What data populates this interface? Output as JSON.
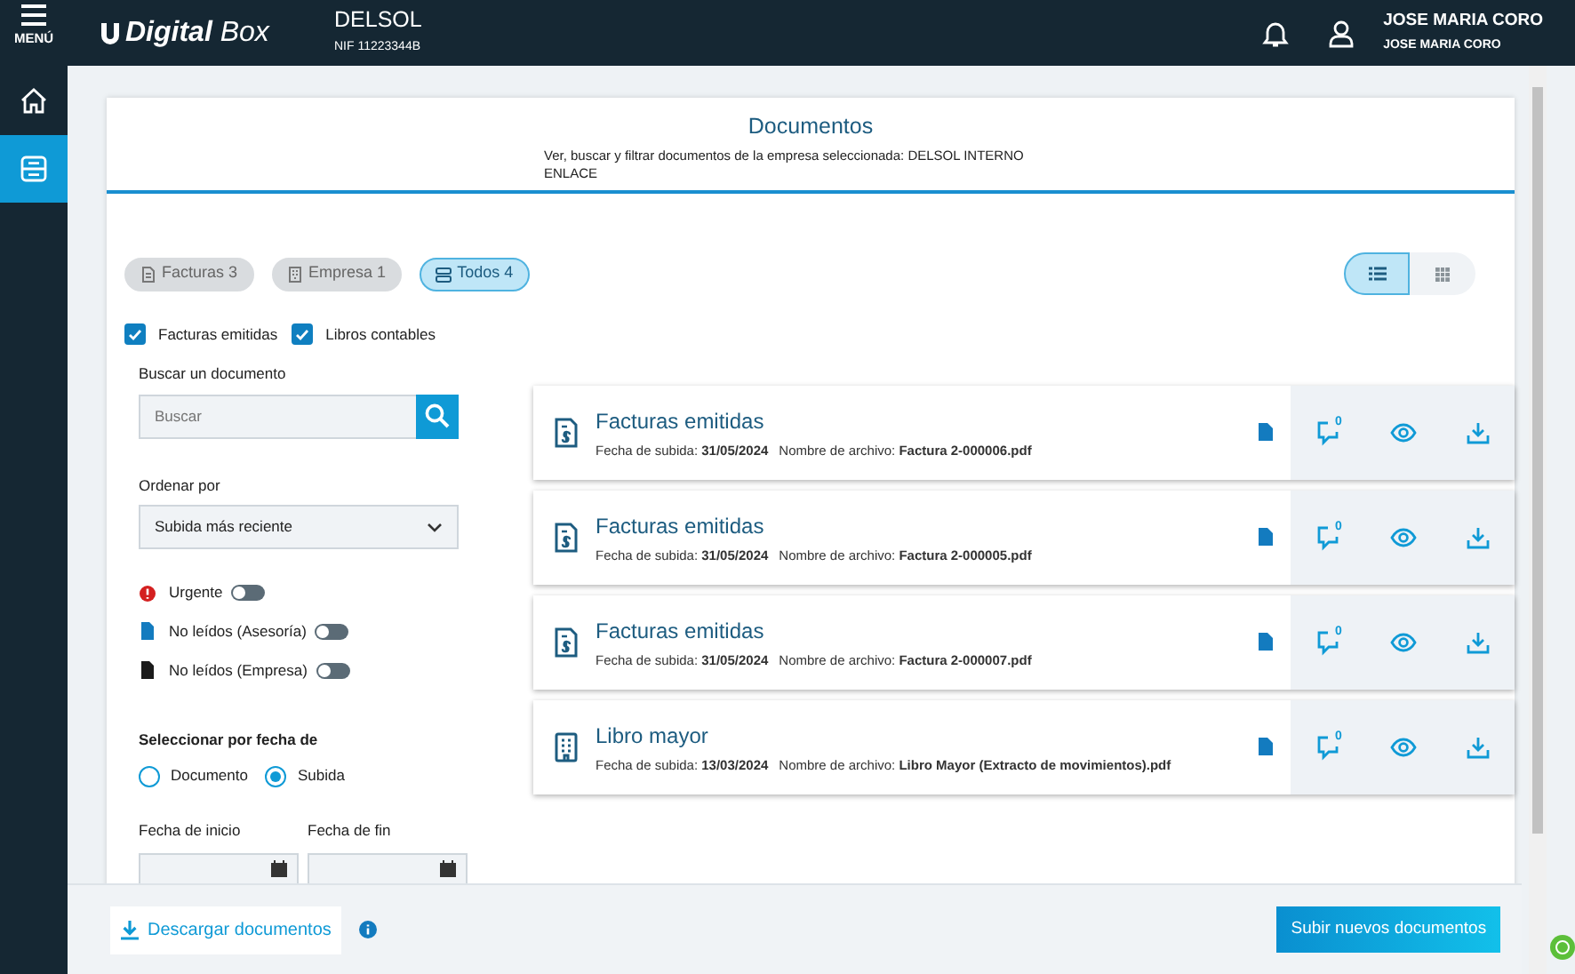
{
  "header": {
    "menu_label": "MENÚ",
    "brand_bold": "Digital",
    "brand_light": "Box",
    "company": "DELSOL",
    "nif": "NIF 11223344B",
    "user_name": "JOSE MARIA CORO",
    "user_sub": "JOSE MARIA CORO"
  },
  "sidebar": {
    "items": [
      {
        "kind": "home",
        "selected": false
      },
      {
        "kind": "documents",
        "selected": true
      }
    ]
  },
  "page": {
    "title": "Documentos",
    "subtitle": "Ver, buscar y filtrar documentos de la empresa seleccionada: DELSOL INTERNO ENLACE"
  },
  "chips": [
    {
      "kind": "invoice",
      "label": "Facturas 3",
      "selected": false
    },
    {
      "kind": "company",
      "label": "Empresa 1",
      "selected": false
    },
    {
      "kind": "all",
      "label": "Todos 4",
      "selected": true
    }
  ],
  "view_toggle": [
    {
      "kind": "list",
      "selected": true
    },
    {
      "kind": "grid",
      "selected": false
    }
  ],
  "type_filters": [
    {
      "label": "Facturas emitidas",
      "checked": true
    },
    {
      "label": "Libros contables",
      "checked": true
    }
  ],
  "search": {
    "label": "Buscar un documento",
    "placeholder": "Buscar"
  },
  "sort": {
    "label": "Ordenar por",
    "value": "Subida más reciente"
  },
  "toggles": [
    {
      "kind": "urgent",
      "label": "Urgente",
      "on": false
    },
    {
      "kind": "unread_advisor",
      "label": "No leídos (Asesoría)",
      "on": false
    },
    {
      "kind": "unread_company",
      "label": "No leídos (Empresa)",
      "on": false
    }
  ],
  "date_mode": {
    "label": "Seleccionar por fecha de",
    "options": [
      {
        "label": "Documento",
        "selected": false
      },
      {
        "label": "Subida",
        "selected": true
      }
    ]
  },
  "date_range": {
    "start_label": "Fecha de inicio",
    "end_label": "Fecha de fin"
  },
  "documents": [
    {
      "kind": "invoice",
      "title": "Facturas emitidas",
      "date_label": "Fecha de subida:",
      "date": "31/05/2024",
      "file_label": "Nombre de archivo:",
      "file": "Factura 2-000006.pdf",
      "comments": "0"
    },
    {
      "kind": "invoice",
      "title": "Facturas emitidas",
      "date_label": "Fecha de subida:",
      "date": "31/05/2024",
      "file_label": "Nombre de archivo:",
      "file": "Factura 2-000005.pdf",
      "comments": "0"
    },
    {
      "kind": "invoice",
      "title": "Facturas emitidas",
      "date_label": "Fecha de subida:",
      "date": "31/05/2024",
      "file_label": "Nombre de archivo:",
      "file": "Factura 2-000007.pdf",
      "comments": "0"
    },
    {
      "kind": "ledger",
      "title": "Libro mayor",
      "date_label": "Fecha de subida:",
      "date": "13/03/2024",
      "file_label": "Nombre de archivo:",
      "file": "Libro Mayor (Extracto de movimientos).pdf",
      "comments": "0"
    }
  ],
  "footer": {
    "download": "Descargar documentos",
    "upload": "Subir nuevos documentos"
  }
}
